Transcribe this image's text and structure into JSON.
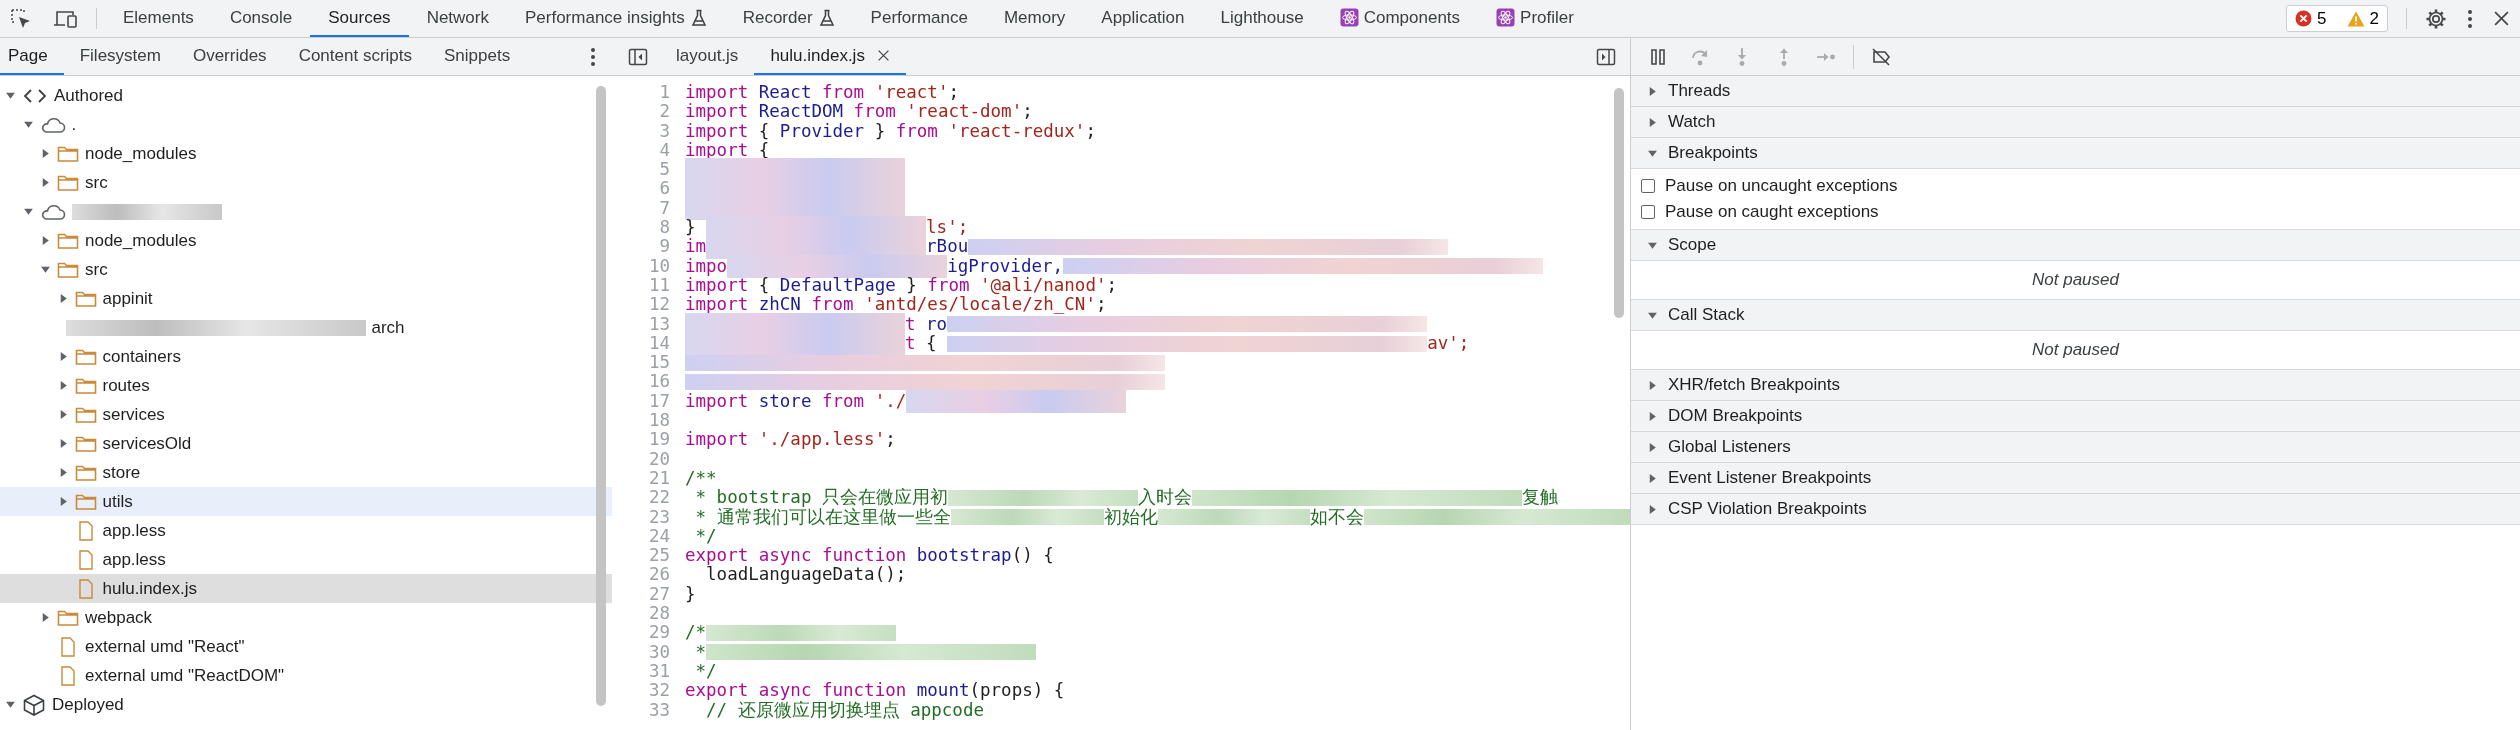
{
  "toolbar": {
    "tabs": [
      {
        "label": "Elements",
        "selected": false,
        "kind": "plain"
      },
      {
        "label": "Console",
        "selected": false,
        "kind": "plain"
      },
      {
        "label": "Sources",
        "selected": true,
        "kind": "plain"
      },
      {
        "label": "Network",
        "selected": false,
        "kind": "plain"
      },
      {
        "label": "Performance insights",
        "selected": false,
        "kind": "experiment"
      },
      {
        "label": "Recorder",
        "selected": false,
        "kind": "experiment"
      },
      {
        "label": "Performance",
        "selected": false,
        "kind": "plain"
      },
      {
        "label": "Memory",
        "selected": false,
        "kind": "plain"
      },
      {
        "label": "Application",
        "selected": false,
        "kind": "plain"
      },
      {
        "label": "Lighthouse",
        "selected": false,
        "kind": "plain"
      },
      {
        "label": "Components",
        "selected": false,
        "kind": "extension"
      },
      {
        "label": "Profiler",
        "selected": false,
        "kind": "extension"
      }
    ],
    "issues": {
      "errors": "5",
      "warnings": "2"
    }
  },
  "navigator": {
    "tabs": [
      {
        "label": "Page",
        "selected": true
      },
      {
        "label": "Filesystem",
        "selected": false
      },
      {
        "label": "Overrides",
        "selected": false
      },
      {
        "label": "Content scripts",
        "selected": false
      },
      {
        "label": "Snippets",
        "selected": false
      }
    ],
    "tree": [
      {
        "label": "Authored",
        "kind": "source-group",
        "expanded": true,
        "selected": false,
        "hovered": false,
        "children": [
          {
            "label": ".",
            "kind": "cloud",
            "expanded": true,
            "selected": false,
            "hovered": false,
            "children": [
              {
                "label": "node_modules",
                "kind": "folder",
                "expanded": false,
                "selected": false,
                "hovered": false
              },
              {
                "label": "src",
                "kind": "folder",
                "expanded": false,
                "selected": false,
                "hovered": false
              }
            ]
          },
          {
            "kind": "blurred-cloud",
            "expanded": true,
            "selected": false,
            "hovered": false,
            "children": [
              {
                "label": "node_modules",
                "kind": "folder",
                "expanded": false,
                "selected": false,
                "hovered": false
              },
              {
                "label": "src",
                "kind": "folder",
                "expanded": true,
                "selected": false,
                "hovered": false,
                "children": [
                  {
                    "label": "appinit",
                    "kind": "folder",
                    "expanded": false,
                    "selected": false,
                    "hovered": false
                  },
                  {
                    "label": "arch",
                    "kind": "blurred",
                    "selected": false,
                    "hovered": false
                  },
                  {
                    "label": "containers",
                    "kind": "folder",
                    "expanded": false,
                    "selected": false,
                    "hovered": false
                  },
                  {
                    "label": "routes",
                    "kind": "folder",
                    "expanded": false,
                    "selected": false,
                    "hovered": false
                  },
                  {
                    "label": "services",
                    "kind": "folder",
                    "expanded": false,
                    "selected": false,
                    "hovered": false
                  },
                  {
                    "label": "servicesOld",
                    "kind": "folder",
                    "expanded": false,
                    "selected": false,
                    "hovered": false
                  },
                  {
                    "label": "store",
                    "kind": "folder",
                    "expanded": false,
                    "selected": false,
                    "hovered": false
                  },
                  {
                    "label": "utils",
                    "kind": "folder",
                    "expanded": false,
                    "selected": false,
                    "hovered": true
                  },
                  {
                    "label": "app.less",
                    "kind": "file",
                    "selected": false,
                    "hovered": false
                  },
                  {
                    "label": "app.less",
                    "kind": "file",
                    "selected": false,
                    "hovered": false
                  },
                  {
                    "label": "hulu.index.js",
                    "kind": "file",
                    "selected": true,
                    "hovered": false
                  }
                ]
              },
              {
                "label": "webpack",
                "kind": "folder",
                "expanded": false,
                "selected": false,
                "hovered": false
              },
              {
                "label": "external umd \"React\"",
                "kind": "file",
                "selected": false,
                "hovered": false
              },
              {
                "label": "external umd \"ReactDOM\"",
                "kind": "file",
                "selected": false,
                "hovered": false
              }
            ]
          }
        ]
      },
      {
        "label": "Deployed",
        "kind": "package-group",
        "expanded": true,
        "selected": false,
        "hovered": false
      }
    ]
  },
  "editor": {
    "tabs": [
      {
        "label": "layout.js",
        "selected": false,
        "closable": false
      },
      {
        "label": "hulu.index.js",
        "selected": true,
        "closable": true
      }
    ],
    "lines": [
      {
        "n": "1",
        "tokens": [
          {
            "kind": "keyword",
            "text": "import "
          },
          {
            "kind": "def",
            "text": "React "
          },
          {
            "kind": "keyword",
            "text": "from "
          },
          {
            "kind": "string",
            "text": "'react'"
          },
          {
            "kind": "plain",
            "text": ";"
          }
        ]
      },
      {
        "n": "2",
        "tokens": [
          {
            "kind": "keyword",
            "text": "import "
          },
          {
            "kind": "def",
            "text": "ReactDOM "
          },
          {
            "kind": "keyword",
            "text": "from "
          },
          {
            "kind": "string",
            "text": "'react-dom'"
          },
          {
            "kind": "plain",
            "text": ";"
          }
        ]
      },
      {
        "n": "3",
        "tokens": [
          {
            "kind": "keyword",
            "text": "import "
          },
          {
            "kind": "plain",
            "text": "{ "
          },
          {
            "kind": "def",
            "text": "Provider "
          },
          {
            "kind": "plain",
            "text": "} "
          },
          {
            "kind": "keyword",
            "text": "from "
          },
          {
            "kind": "string",
            "text": "'react-redux'"
          },
          {
            "kind": "plain",
            "text": ";"
          }
        ]
      },
      {
        "n": "4",
        "tokens": [
          {
            "kind": "keyword",
            "text": "import "
          },
          {
            "kind": "plain",
            "text": "{"
          }
        ]
      },
      {
        "n": "5",
        "tokens": [
          {
            "kind": "blur"
          }
        ]
      },
      {
        "n": "6",
        "tokens": [
          {
            "kind": "blur"
          }
        ]
      },
      {
        "n": "7",
        "tokens": [
          {
            "kind": "blur"
          }
        ]
      },
      {
        "n": "8",
        "tokens": [
          {
            "kind": "plain",
            "text": "} "
          },
          {
            "kind": "blur"
          },
          {
            "kind": "string",
            "text": "ls';"
          }
        ]
      },
      {
        "n": "9",
        "tokens": [
          {
            "kind": "keyword",
            "text": "im"
          },
          {
            "kind": "blur"
          },
          {
            "kind": "def",
            "text": "rBou"
          },
          {
            "kind": "blur-long"
          }
        ]
      },
      {
        "n": "10",
        "tokens": [
          {
            "kind": "keyword",
            "text": "impo"
          },
          {
            "kind": "blur"
          },
          {
            "kind": "def",
            "text": "igProvider,"
          },
          {
            "kind": "blur-long"
          }
        ]
      },
      {
        "n": "11",
        "tokens": [
          {
            "kind": "keyword",
            "text": "import "
          },
          {
            "kind": "plain",
            "text": "{ "
          },
          {
            "kind": "def",
            "text": "DefaultPage "
          },
          {
            "kind": "plain",
            "text": "} "
          },
          {
            "kind": "keyword",
            "text": "from "
          },
          {
            "kind": "string",
            "text": "'@ali/nanod'"
          },
          {
            "kind": "plain",
            "text": ";"
          }
        ]
      },
      {
        "n": "12",
        "tokens": [
          {
            "kind": "keyword",
            "text": "import "
          },
          {
            "kind": "def",
            "text": "zhCN "
          },
          {
            "kind": "keyword",
            "text": "from "
          },
          {
            "kind": "string",
            "text": "'antd/es/locale/zh_CN'"
          },
          {
            "kind": "plain",
            "text": ";"
          }
        ]
      },
      {
        "n": "13",
        "tokens": [
          {
            "kind": "blur"
          },
          {
            "kind": "keyword",
            "text": "t "
          },
          {
            "kind": "def",
            "text": "ro"
          },
          {
            "kind": "blur-long"
          }
        ]
      },
      {
        "n": "14",
        "tokens": [
          {
            "kind": "blur"
          },
          {
            "kind": "keyword",
            "text": "t "
          },
          {
            "kind": "plain",
            "text": "{ "
          },
          {
            "kind": "blur-long"
          },
          {
            "kind": "string",
            "text": "av';"
          }
        ]
      },
      {
        "n": "15",
        "tokens": [
          {
            "kind": "blur-long"
          }
        ]
      },
      {
        "n": "16",
        "tokens": [
          {
            "kind": "blur-long"
          }
        ]
      },
      {
        "n": "17",
        "tokens": [
          {
            "kind": "keyword",
            "text": "import "
          },
          {
            "kind": "def",
            "text": "store "
          },
          {
            "kind": "keyword",
            "text": "from "
          },
          {
            "kind": "string",
            "text": "'./"
          },
          {
            "kind": "blur"
          }
        ]
      },
      {
        "n": "18"
      },
      {
        "n": "19",
        "tokens": [
          {
            "kind": "keyword",
            "text": "import "
          },
          {
            "kind": "string",
            "text": "'./app.less'"
          },
          {
            "kind": "plain",
            "text": ";"
          }
        ]
      },
      {
        "n": "20"
      },
      {
        "n": "21",
        "tokens": [
          {
            "kind": "comment",
            "text": "/**"
          }
        ]
      },
      {
        "n": "22",
        "tokens": [
          {
            "kind": "comment",
            "text": " * bootstrap 只会在微应用初"
          },
          {
            "kind": "blur-comment"
          },
          {
            "kind": "comment",
            "text": "入时会"
          },
          {
            "kind": "blur-comment-long"
          },
          {
            "kind": "comment",
            "text": "复触"
          }
        ]
      },
      {
        "n": "23",
        "tokens": [
          {
            "kind": "comment",
            "text": " * 通常我们可以在这里做一些全"
          },
          {
            "kind": "blur-comment"
          },
          {
            "kind": "comment",
            "text": "初始化"
          },
          {
            "kind": "blur-comment"
          },
          {
            "kind": "comment",
            "text": "如不会"
          },
          {
            "kind": "blur-comment-long"
          }
        ]
      },
      {
        "n": "24",
        "tokens": [
          {
            "kind": "comment",
            "text": " */"
          }
        ]
      },
      {
        "n": "25",
        "tokens": [
          {
            "kind": "keyword",
            "text": "export async function "
          },
          {
            "kind": "def",
            "text": "bootstrap"
          },
          {
            "kind": "plain",
            "text": "() {"
          }
        ]
      },
      {
        "n": "26",
        "tokens": [
          {
            "kind": "plain",
            "text": "  loadLanguageData();"
          }
        ]
      },
      {
        "n": "27",
        "tokens": [
          {
            "kind": "plain",
            "text": "}"
          }
        ]
      },
      {
        "n": "28"
      },
      {
        "n": "29",
        "tokens": [
          {
            "kind": "comment",
            "text": "/*"
          },
          {
            "kind": "blur-comment"
          }
        ]
      },
      {
        "n": "30",
        "tokens": [
          {
            "kind": "comment",
            "text": " *"
          },
          {
            "kind": "blur-comment-long"
          }
        ]
      },
      {
        "n": "31",
        "tokens": [
          {
            "kind": "comment",
            "text": " */"
          }
        ]
      },
      {
        "n": "32",
        "tokens": [
          {
            "kind": "keyword",
            "text": "export async function "
          },
          {
            "kind": "def",
            "text": "mount"
          },
          {
            "kind": "plain",
            "text": "(props) {"
          }
        ]
      },
      {
        "n": "33",
        "tokens": [
          {
            "kind": "comment",
            "text": "  // 还原微应用切换埋点 appcode"
          }
        ]
      }
    ]
  },
  "debugger": {
    "toolbar": [
      {
        "kind": "pause",
        "disabled": false
      },
      {
        "kind": "step-over",
        "disabled": true
      },
      {
        "kind": "step-into",
        "disabled": true
      },
      {
        "kind": "step-out",
        "disabled": true
      },
      {
        "kind": "step",
        "disabled": true
      },
      {
        "kind": "deactivate",
        "disabled": false
      }
    ],
    "sections": [
      {
        "title": "Threads",
        "expanded": false
      },
      {
        "title": "Watch",
        "expanded": false
      },
      {
        "title": "Breakpoints",
        "expanded": true,
        "checkboxes": [
          {
            "label": "Pause on uncaught exceptions",
            "checked": false
          },
          {
            "label": "Pause on caught exceptions",
            "checked": false
          }
        ]
      },
      {
        "title": "Scope",
        "expanded": true,
        "message": "Not paused"
      },
      {
        "title": "Call Stack",
        "expanded": true,
        "message": "Not paused"
      },
      {
        "title": "XHR/fetch Breakpoints",
        "expanded": false
      },
      {
        "title": "DOM Breakpoints",
        "expanded": false
      },
      {
        "title": "Global Listeners",
        "expanded": false
      },
      {
        "title": "Event Listener Breakpoints",
        "expanded": false
      },
      {
        "title": "CSP Violation Breakpoints",
        "expanded": false
      }
    ]
  }
}
